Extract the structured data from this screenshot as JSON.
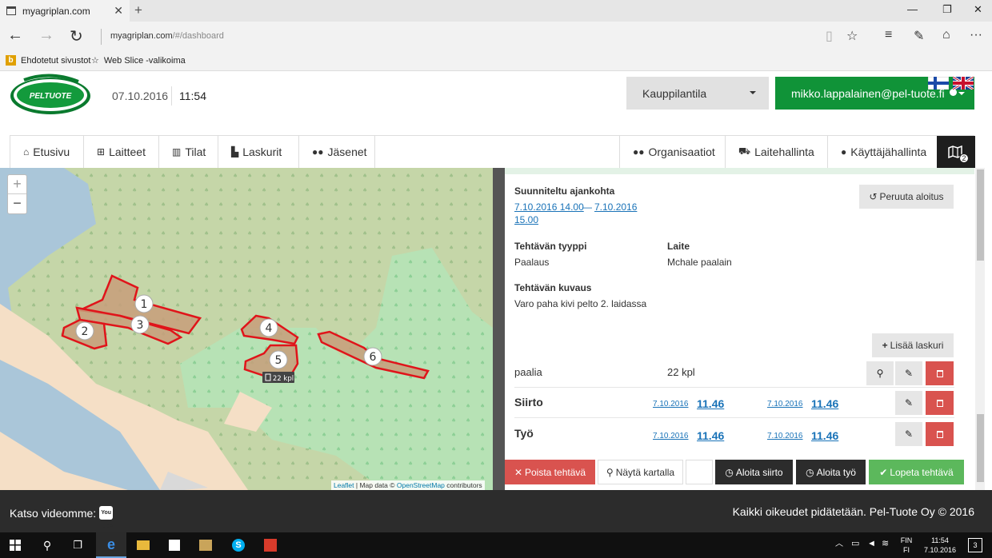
{
  "browser": {
    "tab_title": "myagriplan.com",
    "url_host": "myagriplan.com",
    "url_path": "/#/dashboard",
    "favorites": [
      "Ehdotetut sivustot",
      "Web Slice -valikoima"
    ]
  },
  "header": {
    "logo_text": "PELTUOTE",
    "date": "07.10.2016",
    "time": "11:54",
    "farm_select": "Kauppilantila",
    "user_email": "mikko.lappalainen@pel-tuote.fi"
  },
  "nav": {
    "left": [
      "Etusivu",
      "Laitteet",
      "Tilat",
      "Laskurit",
      "Jäsenet"
    ],
    "right": [
      "Organisaatiot",
      "Laitehallinta",
      "Käyttäjähallinta"
    ],
    "map_badge": "2"
  },
  "map": {
    "zoom_in": "+",
    "zoom_out": "−",
    "field_labels": [
      "1",
      "2",
      "3",
      "4",
      "5",
      "6"
    ],
    "marker_label": "22 kpl",
    "attribution_leaflet": "Leaflet",
    "attribution_mid": " | Map data © ",
    "attribution_osm": "OpenStreetMap",
    "attribution_end": " contributors"
  },
  "task": {
    "planned_label": "Suunniteltu ajankohta",
    "planned_start": "7.10.2016 14.00",
    "planned_dash": " — ",
    "planned_end_date": "7.10.2016",
    "planned_end_time": "15.00",
    "cancel_start": "Peruuta aloitus",
    "type_label": "Tehtävän tyyppi",
    "type_value": "Paalaus",
    "device_label": "Laite",
    "device_value": "Mchale paalain",
    "desc_label": "Tehtävän kuvaus",
    "desc_value": "Varo paha kivi pelto 2. laidassa",
    "add_counter": "Lisää laskuri",
    "counter_name": "paalia",
    "counter_value": "22 kpl",
    "rows": [
      {
        "label": "Siirto",
        "start_date": "7.10.2016",
        "start_time": "11.46",
        "end_date": "7.10.2016",
        "end_time": "11.46"
      },
      {
        "label": "Työ",
        "start_date": "7.10.2016",
        "start_time": "11.46",
        "end_date": "7.10.2016",
        "end_time": "11.46"
      }
    ],
    "actions": {
      "delete": "Poista tehtävä",
      "show_map": "Näytä kartalla",
      "start_transfer": "Aloita siirto",
      "start_work": "Aloita työ",
      "finish": "Lopeta tehtävä"
    }
  },
  "footer": {
    "watch_video": "Katso videomme:",
    "yt_label": "You Tube",
    "copyright": "Kaikki oikeudet pidätetään. Pel-Tuote Oy © 2016"
  },
  "taskbar": {
    "lang": "FIN",
    "lang_sub": "FI",
    "time": "11:54",
    "date": "7.10.2016",
    "notif_count": "3"
  },
  "colors": {
    "green": "#109338",
    "red": "#d9534f",
    "dark": "#2c2c2c",
    "link": "#1a73b8"
  }
}
